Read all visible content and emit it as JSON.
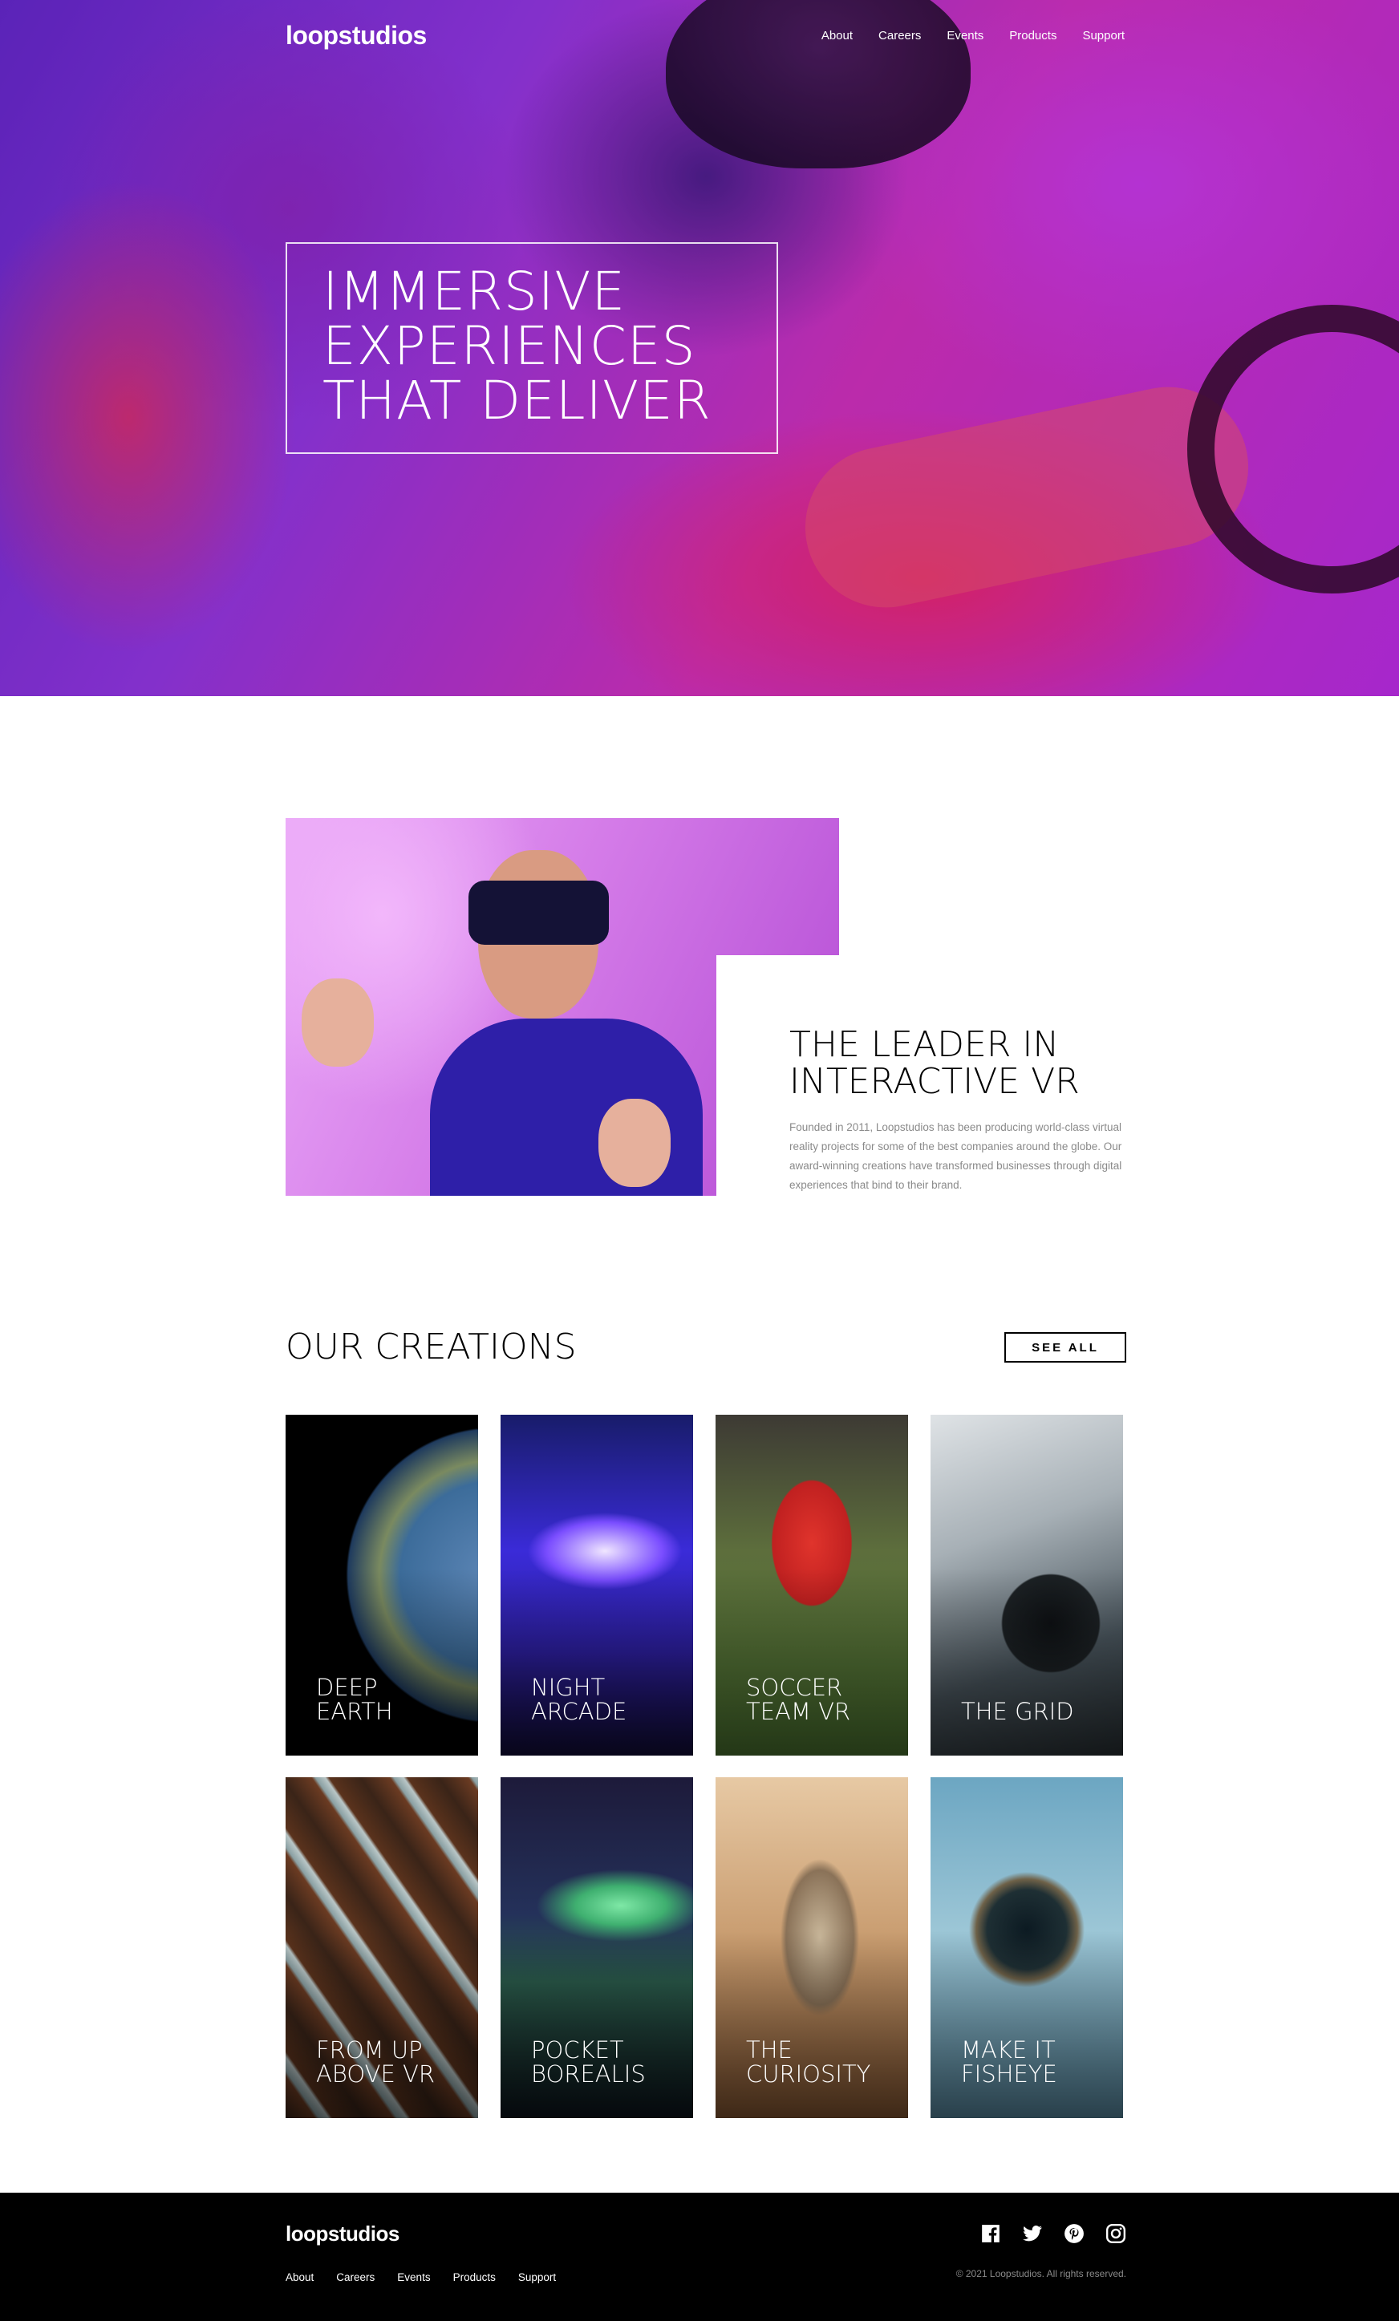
{
  "header": {
    "logo": "loopstudios",
    "nav": [
      "About",
      "Careers",
      "Events",
      "Products",
      "Support"
    ]
  },
  "hero": {
    "title_lines": [
      "IMMERSIVE",
      "EXPERIENCES",
      "THAT DELIVER"
    ]
  },
  "intro": {
    "title_lines": [
      "THE LEADER IN",
      "INTERACTIVE VR"
    ],
    "text": "Founded in 2011, Loopstudios has been producing world-class virtual reality projects for some of the best companies around the globe. Our award-winning creations have transformed businesses through digital experiences that bind to their brand."
  },
  "creations": {
    "title": "OUR CREATIONS",
    "see_all": "SEE ALL",
    "items": [
      {
        "lines": [
          "DEEP",
          "EARTH"
        ]
      },
      {
        "lines": [
          "NIGHT",
          "ARCADE"
        ]
      },
      {
        "lines": [
          "SOCCER",
          "TEAM VR"
        ]
      },
      {
        "lines": [
          "THE GRID"
        ]
      },
      {
        "lines": [
          "FROM UP",
          "ABOVE VR"
        ]
      },
      {
        "lines": [
          "POCKET",
          "BOREALIS"
        ]
      },
      {
        "lines": [
          "THE",
          "CURIOSITY"
        ]
      },
      {
        "lines": [
          "MAKE IT",
          "FISHEYE"
        ]
      }
    ]
  },
  "footer": {
    "logo": "loopstudios",
    "nav": [
      "About",
      "Careers",
      "Events",
      "Products",
      "Support"
    ],
    "copyright": "© 2021 Loopstudios. All rights reserved.",
    "social": [
      "facebook-icon",
      "twitter-icon",
      "pinterest-icon",
      "instagram-icon"
    ]
  },
  "colors": {
    "accent_black": "#000000",
    "footer_text_muted": "#8a8a8a"
  }
}
